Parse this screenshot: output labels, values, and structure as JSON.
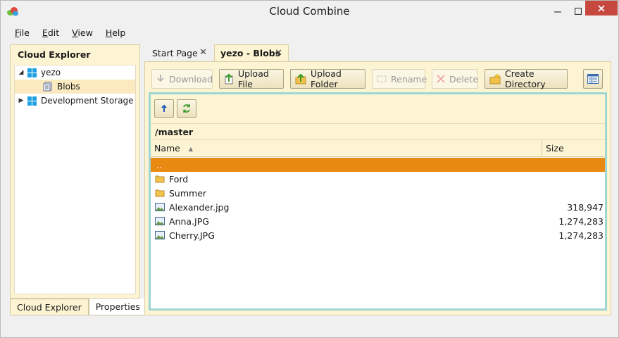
{
  "window": {
    "title": "Cloud Combine"
  },
  "menu": [
    {
      "first": "F",
      "rest": "ile"
    },
    {
      "first": "E",
      "rest": "dit"
    },
    {
      "first": "V",
      "rest": "iew"
    },
    {
      "first": "H",
      "rest": "elp"
    }
  ],
  "explorer": {
    "title": "Cloud Explorer",
    "tree": [
      {
        "label": "yezo",
        "expanded": true
      },
      {
        "label": "Blobs",
        "selected": true
      },
      {
        "label": "Development Storage",
        "expanded": false
      }
    ],
    "tabs": [
      "Cloud Explorer",
      "Properties"
    ]
  },
  "doc_tabs": [
    {
      "label": "Start Page",
      "close": "✕"
    },
    {
      "label": "yezo - Blobs",
      "close": "✕"
    }
  ],
  "toolbar": {
    "download": "Download",
    "upload_file": "Upload File",
    "upload_folder": "Upload Folder",
    "rename": "Rename",
    "delete": "Delete",
    "create_directory": "Create Directory"
  },
  "browser": {
    "path": "/master",
    "columns": {
      "name": "Name",
      "size": "Size"
    },
    "rows": [
      {
        "name": "..",
        "size": "",
        "type": "up"
      },
      {
        "name": "Ford",
        "size": "",
        "type": "folder"
      },
      {
        "name": "Summer",
        "size": "",
        "type": "folder"
      },
      {
        "name": "Alexander.jpg",
        "size": "318,947",
        "type": "image"
      },
      {
        "name": "Anna.JPG",
        "size": "1,274,283",
        "type": "image"
      },
      {
        "name": "Cherry.JPG",
        "size": "1,274,283",
        "type": "image"
      }
    ]
  },
  "colors": {
    "panel": "#fcf4d2",
    "selection": "#e88a12",
    "accent_border": "#9fd6d4",
    "close": "#c7483f"
  }
}
